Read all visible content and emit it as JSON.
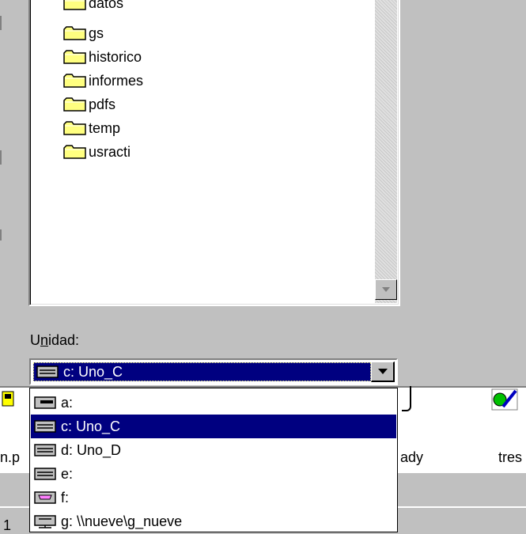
{
  "tree": {
    "items": [
      {
        "label": "datos"
      },
      {
        "label": "gs"
      },
      {
        "label": "historico"
      },
      {
        "label": "informes"
      },
      {
        "label": "pdfs"
      },
      {
        "label": "temp"
      },
      {
        "label": "usracti"
      }
    ]
  },
  "drive": {
    "label_prefix": "U",
    "label_underlined": "n",
    "label_suffix": "idad:",
    "selected": "c: Uno_C",
    "options": [
      {
        "label": "a:",
        "icon": "floppy-drive-icon"
      },
      {
        "label": "c: Uno_C",
        "icon": "hard-drive-icon",
        "selected": true
      },
      {
        "label": "d: Uno_D",
        "icon": "hard-drive-icon"
      },
      {
        "label": "e:",
        "icon": "hard-drive-icon"
      },
      {
        "label": "f:",
        "icon": "cd-drive-icon"
      },
      {
        "label": "g: \\\\nueve\\g_nueve",
        "icon": "network-drive-icon"
      }
    ]
  },
  "background": {
    "text_left": "n.p",
    "text_mid": "ady",
    "text_right": "tres"
  },
  "colors": {
    "selection": "#000080",
    "folder": "#ffff80",
    "face": "#c0c0c0"
  }
}
